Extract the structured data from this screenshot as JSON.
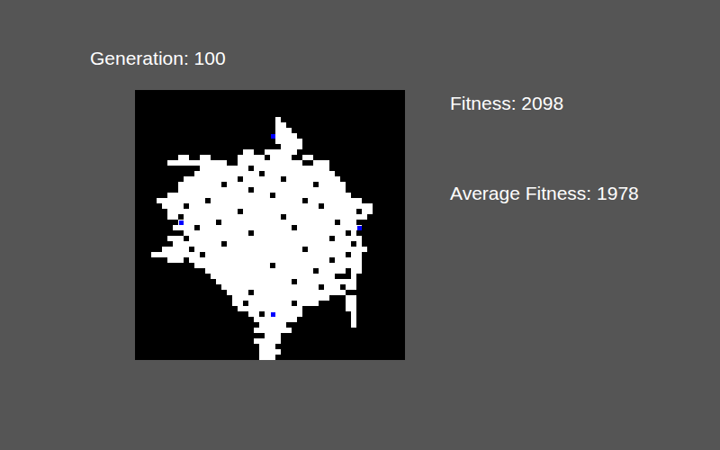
{
  "generation": {
    "label": "Generation: 100"
  },
  "fitness": {
    "label": "Fitness: 2098"
  },
  "average_fitness": {
    "label": "Average Fitness: 1978"
  },
  "grid": {
    "cols": 50,
    "rows": 50,
    "filled": [
      [
        5,
        26,
        26
      ],
      [
        6,
        26,
        27
      ],
      [
        7,
        26,
        28
      ],
      [
        8,
        26,
        29
      ],
      [
        9,
        26,
        30
      ],
      [
        10,
        27,
        30
      ],
      [
        11,
        20,
        21
      ],
      [
        11,
        24,
        29
      ],
      [
        12,
        8,
        9
      ],
      [
        12,
        12,
        13
      ],
      [
        12,
        19,
        23
      ],
      [
        12,
        25,
        28
      ],
      [
        12,
        31,
        32
      ],
      [
        13,
        6,
        16
      ],
      [
        13,
        19,
        30
      ],
      [
        13,
        33,
        35
      ],
      [
        14,
        12,
        20
      ],
      [
        14,
        22,
        35
      ],
      [
        15,
        11,
        22
      ],
      [
        15,
        24,
        36
      ],
      [
        16,
        9,
        18
      ],
      [
        16,
        20,
        26
      ],
      [
        16,
        28,
        37
      ],
      [
        17,
        8,
        15
      ],
      [
        17,
        17,
        32
      ],
      [
        17,
        34,
        38
      ],
      [
        18,
        8,
        20
      ],
      [
        18,
        22,
        38
      ],
      [
        19,
        6,
        24
      ],
      [
        19,
        26,
        39
      ],
      [
        20,
        4,
        12
      ],
      [
        20,
        14,
        30
      ],
      [
        20,
        32,
        41
      ],
      [
        21,
        5,
        8
      ],
      [
        21,
        10,
        33
      ],
      [
        21,
        35,
        43
      ],
      [
        22,
        6,
        18
      ],
      [
        22,
        20,
        40
      ],
      [
        22,
        42,
        43
      ],
      [
        23,
        6,
        7
      ],
      [
        23,
        9,
        26
      ],
      [
        23,
        28,
        42
      ],
      [
        24,
        8,
        14
      ],
      [
        24,
        16,
        36
      ],
      [
        24,
        38,
        40
      ],
      [
        25,
        7,
        10
      ],
      [
        25,
        12,
        28
      ],
      [
        25,
        30,
        41
      ],
      [
        26,
        9,
        20
      ],
      [
        26,
        22,
        38
      ],
      [
        26,
        40,
        40
      ],
      [
        27,
        6,
        8
      ],
      [
        27,
        10,
        35
      ],
      [
        27,
        37,
        41
      ],
      [
        28,
        7,
        15
      ],
      [
        28,
        17,
        39
      ],
      [
        28,
        41,
        41
      ],
      [
        29,
        5,
        9
      ],
      [
        29,
        11,
        30
      ],
      [
        29,
        32,
        42
      ],
      [
        30,
        3,
        11
      ],
      [
        30,
        13,
        38
      ],
      [
        30,
        40,
        41
      ],
      [
        31,
        6,
        8
      ],
      [
        31,
        10,
        35
      ],
      [
        31,
        37,
        41
      ],
      [
        32,
        11,
        24
      ],
      [
        32,
        26,
        41
      ],
      [
        33,
        13,
        32
      ],
      [
        33,
        34,
        38
      ],
      [
        33,
        40,
        41
      ],
      [
        34,
        14,
        36
      ],
      [
        34,
        40,
        40
      ],
      [
        35,
        15,
        28
      ],
      [
        35,
        30,
        40
      ],
      [
        36,
        16,
        33
      ],
      [
        36,
        35,
        37
      ],
      [
        36,
        39,
        40
      ],
      [
        37,
        17,
        20
      ],
      [
        37,
        22,
        38
      ],
      [
        38,
        18,
        35
      ],
      [
        38,
        39,
        40
      ],
      [
        39,
        18,
        19
      ],
      [
        39,
        21,
        28
      ],
      [
        39,
        30,
        33
      ],
      [
        39,
        39,
        40
      ],
      [
        40,
        19,
        30
      ],
      [
        40,
        39,
        40
      ],
      [
        41,
        21,
        22
      ],
      [
        41,
        24,
        30
      ],
      [
        41,
        40,
        40
      ],
      [
        42,
        22,
        29
      ],
      [
        42,
        40,
        40
      ],
      [
        43,
        23,
        27
      ],
      [
        43,
        40,
        40
      ],
      [
        44,
        22,
        28
      ],
      [
        45,
        24,
        26
      ],
      [
        46,
        22,
        26
      ],
      [
        47,
        23,
        25
      ],
      [
        48,
        23,
        26
      ],
      [
        49,
        23,
        25
      ]
    ],
    "agents": [
      {
        "row": 8,
        "col": 25
      },
      {
        "row": 24,
        "col": 8
      },
      {
        "row": 25,
        "col": 41
      },
      {
        "row": 41,
        "col": 25
      }
    ]
  }
}
